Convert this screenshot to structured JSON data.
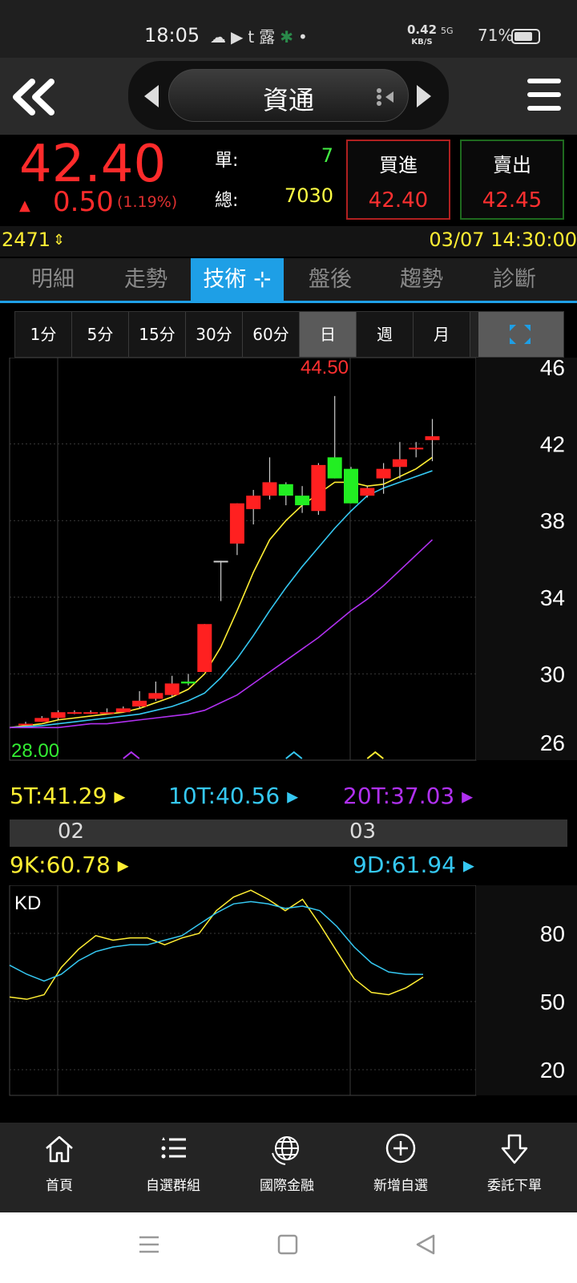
{
  "status_bar": {
    "time": "18:05",
    "icons": [
      "cloud-icon",
      "youtube-icon",
      "tumblr-icon",
      "app-icon",
      "leaf-icon",
      "dot-icon"
    ],
    "app_char": "露",
    "net_speed": "0.42",
    "net_unit": "KB/S",
    "signal": "5G",
    "battery": "71%"
  },
  "header": {
    "stock_name": "資通"
  },
  "quote": {
    "price": "42.40",
    "change": "0.50",
    "change_pct": "(1.19%)",
    "single_label": "單:",
    "single_value": "7",
    "total_label": "總:",
    "total_value": "7030",
    "buy_label": "買進",
    "buy_price": "42.40",
    "sell_label": "賣出",
    "sell_price": "42.45"
  },
  "info_strip": {
    "code": "2471",
    "timestamp": "03/07 14:30:00"
  },
  "tabs": [
    {
      "label": "明細",
      "active": false
    },
    {
      "label": "走勢",
      "active": false
    },
    {
      "label": "技術",
      "active": true
    },
    {
      "label": "盤後",
      "active": false
    },
    {
      "label": "趨勢",
      "active": false
    },
    {
      "label": "診斷",
      "active": false
    }
  ],
  "periods": [
    {
      "label": "1分",
      "selected": false
    },
    {
      "label": "5分",
      "selected": false
    },
    {
      "label": "15分",
      "selected": false
    },
    {
      "label": "30分",
      "selected": false
    },
    {
      "label": "60分",
      "selected": false
    },
    {
      "label": "日",
      "selected": true
    },
    {
      "label": "週",
      "selected": false
    },
    {
      "label": "月",
      "selected": false
    }
  ],
  "ma_legend": [
    {
      "label": "5T:41.29",
      "color": "#ffee33"
    },
    {
      "label": "10T:40.56",
      "color": "#35c8f2"
    },
    {
      "label": "20T:37.03",
      "color": "#b030f0"
    }
  ],
  "dates": [
    "02",
    "03"
  ],
  "kd_legend": [
    {
      "label": "9K:60.78",
      "color": "#ffee33"
    },
    {
      "label": "9D:61.94",
      "color": "#35c8f2"
    }
  ],
  "bottom_nav": [
    {
      "label": "首頁",
      "icon": "home-icon"
    },
    {
      "label": "自選群組",
      "icon": "list-icon"
    },
    {
      "label": "國際金融",
      "icon": "globe-icon"
    },
    {
      "label": "新增自選",
      "icon": "add-circle-icon"
    },
    {
      "label": "委託下單",
      "icon": "order-arrow-icon"
    }
  ],
  "chart_data": [
    {
      "type": "candlestick",
      "title": "",
      "ylim": [
        26,
        46
      ],
      "y_ticks": [
        "46",
        "42",
        "38",
        "34",
        "30",
        "26"
      ],
      "y_tick_values": [
        46,
        42,
        38,
        34,
        30,
        26
      ],
      "high_label": "44.50",
      "low_label": "28.00",
      "candles": [
        {
          "o": 27.4,
          "c": 27.4,
          "h": 27.5,
          "l": 27.3
        },
        {
          "o": 27.5,
          "c": 27.7,
          "h": 27.8,
          "l": 27.5
        },
        {
          "o": 27.7,
          "c": 28.0,
          "h": 28.1,
          "l": 27.6
        },
        {
          "o": 28.0,
          "c": 28.0,
          "h": 28.1,
          "l": 27.9
        },
        {
          "o": 28.0,
          "c": 28.0,
          "h": 28.1,
          "l": 27.9
        },
        {
          "o": 28.0,
          "c": 28.0,
          "h": 28.2,
          "l": 27.9
        },
        {
          "o": 28.0,
          "c": 28.2,
          "h": 28.3,
          "l": 28.0
        },
        {
          "o": 28.3,
          "c": 28.6,
          "h": 29.1,
          "l": 28.2
        },
        {
          "o": 28.7,
          "c": 29.0,
          "h": 29.6,
          "l": 28.6
        },
        {
          "o": 28.9,
          "c": 29.5,
          "h": 29.9,
          "l": 28.8
        },
        {
          "o": 29.6,
          "c": 29.5,
          "h": 30.0,
          "l": 29.4
        },
        {
          "o": 30.1,
          "c": 32.6,
          "h": 32.6,
          "l": 30.1
        },
        {
          "o": 35.9,
          "c": 35.9,
          "h": 35.9,
          "l": 33.8
        },
        {
          "o": 36.8,
          "c": 38.9,
          "h": 38.9,
          "l": 36.2
        },
        {
          "o": 38.6,
          "c": 39.3,
          "h": 39.6,
          "l": 37.8
        },
        {
          "o": 39.3,
          "c": 40.0,
          "h": 41.3,
          "l": 39.1
        },
        {
          "o": 39.9,
          "c": 39.3,
          "h": 40.0,
          "l": 38.8
        },
        {
          "o": 39.3,
          "c": 38.8,
          "h": 39.8,
          "l": 38.4
        },
        {
          "o": 38.5,
          "c": 40.9,
          "h": 41.0,
          "l": 38.3
        },
        {
          "o": 41.3,
          "c": 40.2,
          "h": 44.5,
          "l": 40.2
        },
        {
          "o": 40.7,
          "c": 38.9,
          "h": 40.8,
          "l": 38.9
        },
        {
          "o": 39.3,
          "c": 39.7,
          "h": 39.8,
          "l": 39.2
        },
        {
          "o": 40.2,
          "c": 40.7,
          "h": 41.0,
          "l": 39.4
        },
        {
          "o": 40.8,
          "c": 41.2,
          "h": 42.1,
          "l": 40.2
        },
        {
          "o": 41.8,
          "c": 41.8,
          "h": 42.1,
          "l": 41.3
        },
        {
          "o": 42.2,
          "c": 42.4,
          "h": 43.3,
          "l": 41.1
        }
      ],
      "series": [
        {
          "name": "5T",
          "color": "#ffee33",
          "values": [
            27.2,
            27.4,
            27.6,
            27.7,
            27.8,
            27.9,
            28.0,
            28.2,
            28.5,
            28.8,
            29.2,
            30.0,
            31.4,
            33.3,
            35.3,
            37.0,
            38.0,
            38.8,
            39.4,
            40.0,
            40.0,
            39.8,
            39.9,
            40.3,
            40.7,
            41.3
          ]
        },
        {
          "name": "10T",
          "color": "#35c8f2",
          "values": [
            27.2,
            27.3,
            27.4,
            27.5,
            27.6,
            27.7,
            27.8,
            27.9,
            28.1,
            28.3,
            28.6,
            29.0,
            29.8,
            30.8,
            32.0,
            33.3,
            34.5,
            35.6,
            36.6,
            37.6,
            38.5,
            39.3,
            39.7,
            40.0,
            40.3,
            40.6
          ]
        },
        {
          "name": "20T",
          "color": "#b030f0",
          "values": [
            27.2,
            27.2,
            27.2,
            27.3,
            27.4,
            27.4,
            27.5,
            27.6,
            27.7,
            27.8,
            27.9,
            28.1,
            28.5,
            28.9,
            29.5,
            30.1,
            30.7,
            31.3,
            31.9,
            32.6,
            33.3,
            33.9,
            34.6,
            35.4,
            36.2,
            37.0
          ]
        }
      ],
      "markers": [
        {
          "index": 6,
          "color": "#b030f0"
        },
        {
          "index": 16,
          "color": "#35c8f2"
        },
        {
          "index": 21,
          "color": "#ffee33"
        }
      ]
    },
    {
      "type": "line",
      "title": "KD",
      "ylim": [
        0,
        100
      ],
      "y_ticks": [
        "80",
        "50",
        "20"
      ],
      "y_tick_values": [
        80,
        50,
        20
      ],
      "series": [
        {
          "name": "9K",
          "color": "#ffee33",
          "values": [
            52,
            51,
            53,
            65,
            73,
            79,
            77,
            78,
            78,
            75,
            78,
            80,
            90,
            96,
            99,
            95,
            90,
            95,
            84,
            72,
            60,
            54,
            53,
            56,
            60.78
          ]
        },
        {
          "name": "9D",
          "color": "#35c8f2",
          "values": [
            66,
            62,
            59,
            62,
            68,
            72,
            74,
            75,
            75,
            77,
            79,
            84,
            89,
            93,
            94,
            93,
            91,
            92,
            90,
            83,
            74,
            67,
            63,
            62,
            61.94
          ]
        }
      ]
    }
  ]
}
